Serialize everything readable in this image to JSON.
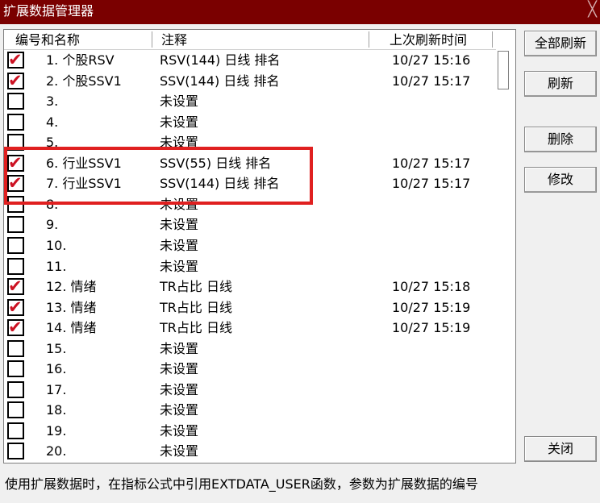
{
  "window": {
    "title": "扩展数据管理器",
    "close_glyph": "╳"
  },
  "columns": {
    "name": "编号和名称",
    "comment": "注释",
    "time": "上次刷新时间"
  },
  "rows": [
    {
      "checked": true,
      "name": "1. 个股RSV",
      "comment": "RSV(144) 日线 排名",
      "time": "10/27 15:16"
    },
    {
      "checked": true,
      "name": "2. 个股SSV1",
      "comment": "SSV(144) 日线 排名",
      "time": "10/27 15:17"
    },
    {
      "checked": false,
      "name": "3.",
      "comment": "未设置",
      "time": ""
    },
    {
      "checked": false,
      "name": "4.",
      "comment": "未设置",
      "time": ""
    },
    {
      "checked": false,
      "name": "5.",
      "comment": "未设置",
      "time": ""
    },
    {
      "checked": true,
      "name": "6. 行业SSV1",
      "comment": "SSV(55) 日线 排名",
      "time": "10/27 15:17"
    },
    {
      "checked": true,
      "name": "7. 行业SSV1",
      "comment": "SSV(144) 日线 排名",
      "time": "10/27 15:17"
    },
    {
      "checked": false,
      "name": "8.",
      "comment": "未设置",
      "time": ""
    },
    {
      "checked": false,
      "name": "9.",
      "comment": "未设置",
      "time": ""
    },
    {
      "checked": false,
      "name": "10.",
      "comment": "未设置",
      "time": ""
    },
    {
      "checked": false,
      "name": "11.",
      "comment": "未设置",
      "time": ""
    },
    {
      "checked": true,
      "name": "12. 情绪",
      "comment": "TR占比 日线",
      "time": "10/27 15:18"
    },
    {
      "checked": true,
      "name": "13. 情绪",
      "comment": "TR占比 日线",
      "time": "10/27 15:19"
    },
    {
      "checked": true,
      "name": "14. 情绪",
      "comment": "TR占比 日线",
      "time": "10/27 15:19"
    },
    {
      "checked": false,
      "name": "15.",
      "comment": "未设置",
      "time": ""
    },
    {
      "checked": false,
      "name": "16.",
      "comment": "未设置",
      "time": ""
    },
    {
      "checked": false,
      "name": "17.",
      "comment": "未设置",
      "time": ""
    },
    {
      "checked": false,
      "name": "18.",
      "comment": "未设置",
      "time": ""
    },
    {
      "checked": false,
      "name": "19.",
      "comment": "未设置",
      "time": ""
    },
    {
      "checked": false,
      "name": "20.",
      "comment": "未设置",
      "time": ""
    }
  ],
  "buttons": {
    "refresh_all": "全部刷新",
    "refresh": "刷新",
    "delete": "删除",
    "modify": "修改",
    "close": "关闭"
  },
  "check_glyph": "✔",
  "status_text": "使用扩展数据时，在指标公式中引用EXTDATA_USER函数，参数为扩展数据的编号",
  "colors": {
    "titlebar": "#7a0000",
    "check": "#cc1122",
    "highlight": "#e02020"
  }
}
